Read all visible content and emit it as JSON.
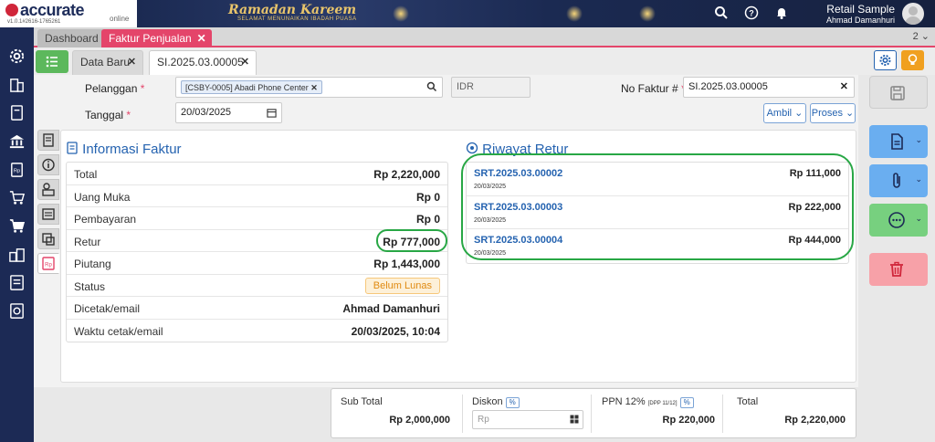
{
  "app": {
    "logo": "accurate",
    "logo_sub": "online",
    "version": "v1.0.1#2616-1765261",
    "banner_title": "Ramadan Kareem",
    "banner_sub": "SELAMAT MENUNAIKAN IBADAH PUASA",
    "user_company": "Retail Sample",
    "user_name": "Ahmad Damanhuri"
  },
  "main_tabs": [
    {
      "label": "Dashboard"
    },
    {
      "label": "Faktur Penjualan"
    }
  ],
  "tab_count": "2",
  "sub_tabs": [
    {
      "label": "Data Baru"
    },
    {
      "label": "SI.2025.03.00005"
    }
  ],
  "form": {
    "pelanggan_label": "Pelanggan",
    "pelanggan_value": "[CSBY-0005] Abadi Phone Center",
    "currency": "IDR",
    "no_faktur_label": "No Faktur #",
    "no_faktur_value": "SI.2025.03.00005",
    "tanggal_label": "Tanggal",
    "tanggal_value": "20/03/2025",
    "ambil_label": "Ambil",
    "proses_label": "Proses",
    "required_mark": "*"
  },
  "info": {
    "title": "Informasi Faktur",
    "rows": [
      {
        "label": "Total",
        "value": "Rp 2,220,000"
      },
      {
        "label": "Uang Muka",
        "value": "Rp 0"
      },
      {
        "label": "Pembayaran",
        "value": "Rp 0"
      },
      {
        "label": "Retur",
        "value": "Rp 777,000"
      },
      {
        "label": "Piutang",
        "value": "Rp 1,443,000"
      },
      {
        "label": "Status",
        "value": "Belum Lunas"
      },
      {
        "label": "Dicetak/email",
        "value": "Ahmad Damanhuri"
      },
      {
        "label": "Waktu cetak/email",
        "value": "20/03/2025, 10:04"
      }
    ]
  },
  "retur": {
    "title": "Riwayat Retur",
    "items": [
      {
        "code": "SRT.2025.03.00002",
        "date": "20/03/2025",
        "amount": "Rp 111,000"
      },
      {
        "code": "SRT.2025.03.00003",
        "date": "20/03/2025",
        "amount": "Rp 222,000"
      },
      {
        "code": "SRT.2025.03.00004",
        "date": "20/03/2025",
        "amount": "Rp 444,000"
      }
    ]
  },
  "footer": {
    "subtotal_label": "Sub Total",
    "subtotal_value": "Rp 2,000,000",
    "diskon_label": "Diskon",
    "diskon_pct": "%",
    "diskon_placeholder": "Rp",
    "ppn_label": "PPN 12%",
    "ppn_note": "[DPP 11/12]",
    "ppn_pct": "%",
    "ppn_value": "Rp 220,000",
    "total_label": "Total",
    "total_value": "Rp 2,220,000"
  },
  "colors": {
    "accent": "#e4456a",
    "nav": "#1c2a55",
    "link": "#2563b0",
    "highlight": "#28a745"
  }
}
